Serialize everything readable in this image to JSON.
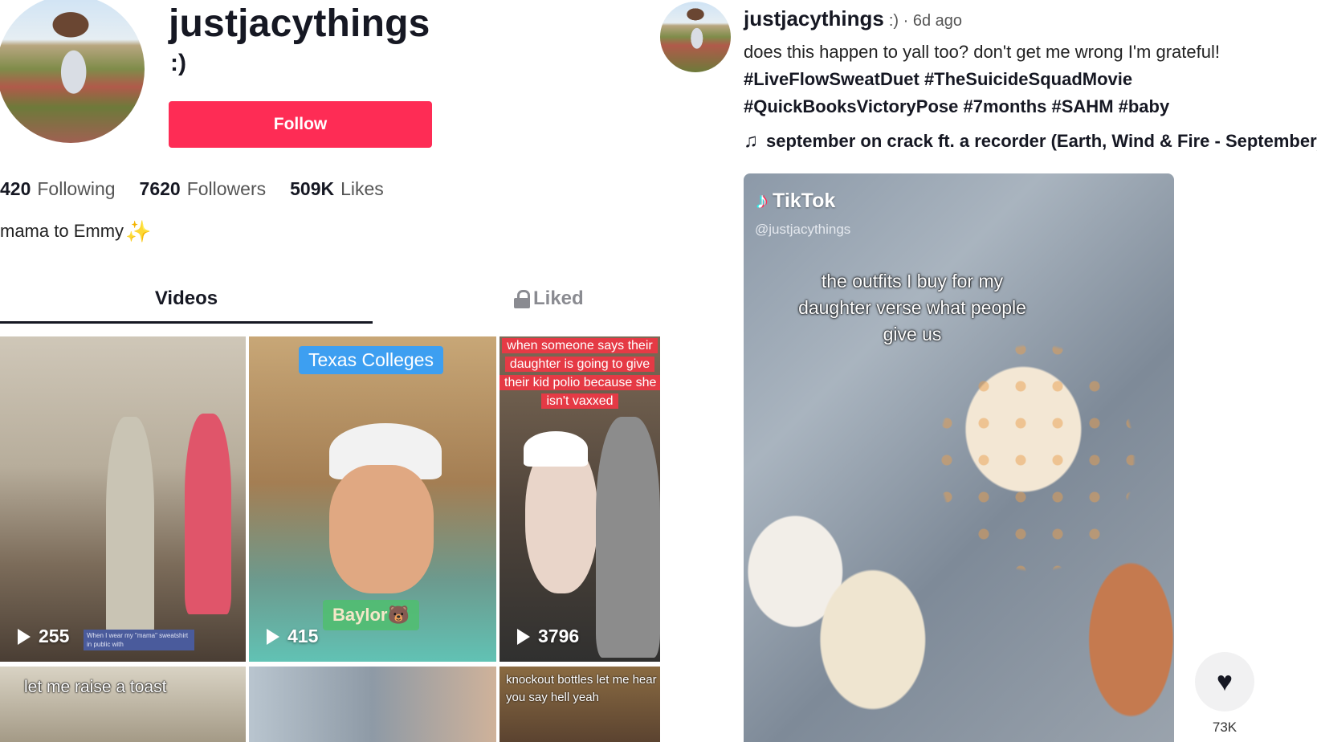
{
  "profile": {
    "username": "justjacythings",
    "subtitle": ":)",
    "follow_label": "Follow",
    "stats": {
      "following_count": "420",
      "following_label": "Following",
      "followers_count": "7620",
      "followers_label": "Followers",
      "likes_count": "509K",
      "likes_label": "Likes"
    },
    "bio": "mama to Emmy",
    "bio_emoji": "✨"
  },
  "tabs": {
    "videos_label": "Videos",
    "liked_label": "Liked"
  },
  "videos": [
    {
      "views": "255",
      "small_caption": "When I wear my \"mama\" sweatshirt in public with"
    },
    {
      "views": "415",
      "tag": "Texas Colleges",
      "subtag": "Baylor🐻"
    },
    {
      "views": "3796",
      "caption": "when someone says their daughter is going to give their kid polio because she isn't vaxxed"
    },
    {
      "caption": "let me raise a toast"
    },
    {},
    {
      "caption": "knockout bottles let me hear you say hell yeah"
    }
  ],
  "post": {
    "username": "justjacythings",
    "meta": ":) · 6d ago",
    "description": "does this happen to yall too? don't get me wrong I'm grateful!",
    "tags_line1": "#LiveFlowSweatDuet #TheSuicideSquadMovie",
    "tags_line2": "#QuickBooksVictoryPose #7months #SAHM #baby",
    "music": "september on crack ft. a recorder (Earth, Wind & Fire - September)",
    "watermark_brand": "TikTok",
    "watermark_handle": "@justjacythings",
    "video_caption": "the outfits I buy for my daughter verse what people give us",
    "like_count": "73K"
  },
  "colors": {
    "follow_button": "#fe2c55",
    "text_primary": "#161823",
    "red_caption": "#e53a45",
    "blue_tag": "#3d9ff1"
  },
  "icons": [
    "play-icon",
    "lock-icon",
    "music-note-icon",
    "heart-icon",
    "tiktok-logo-icon",
    "sparkle-icon"
  ]
}
